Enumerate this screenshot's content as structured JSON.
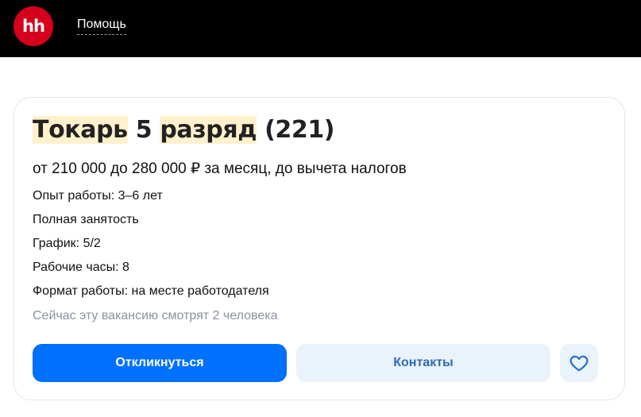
{
  "header": {
    "logo_text": "hh",
    "help_label": "Помощь"
  },
  "vacancy": {
    "title_word1": "Токарь",
    "title_num": "5",
    "title_word2": "разряд",
    "title_code": "(221)",
    "salary": "от 210 000 до 280 000 ₽ за месяц, до вычета налогов",
    "details": [
      "Опыт работы: 3–6 лет",
      "Полная занятость",
      "График: 5/2",
      "Рабочие часы: 8",
      "Формат работы: на месте работодателя"
    ],
    "viewers": "Сейчас эту вакансию смотрят 2 человека"
  },
  "actions": {
    "respond_label": "Откликнуться",
    "contacts_label": "Контакты",
    "favorite_icon": "heart-icon"
  },
  "colors": {
    "brand_red": "#d6001c",
    "primary_blue": "#0070ff",
    "secondary_bg": "#eaf2fc",
    "highlight": "#fff1cc"
  }
}
